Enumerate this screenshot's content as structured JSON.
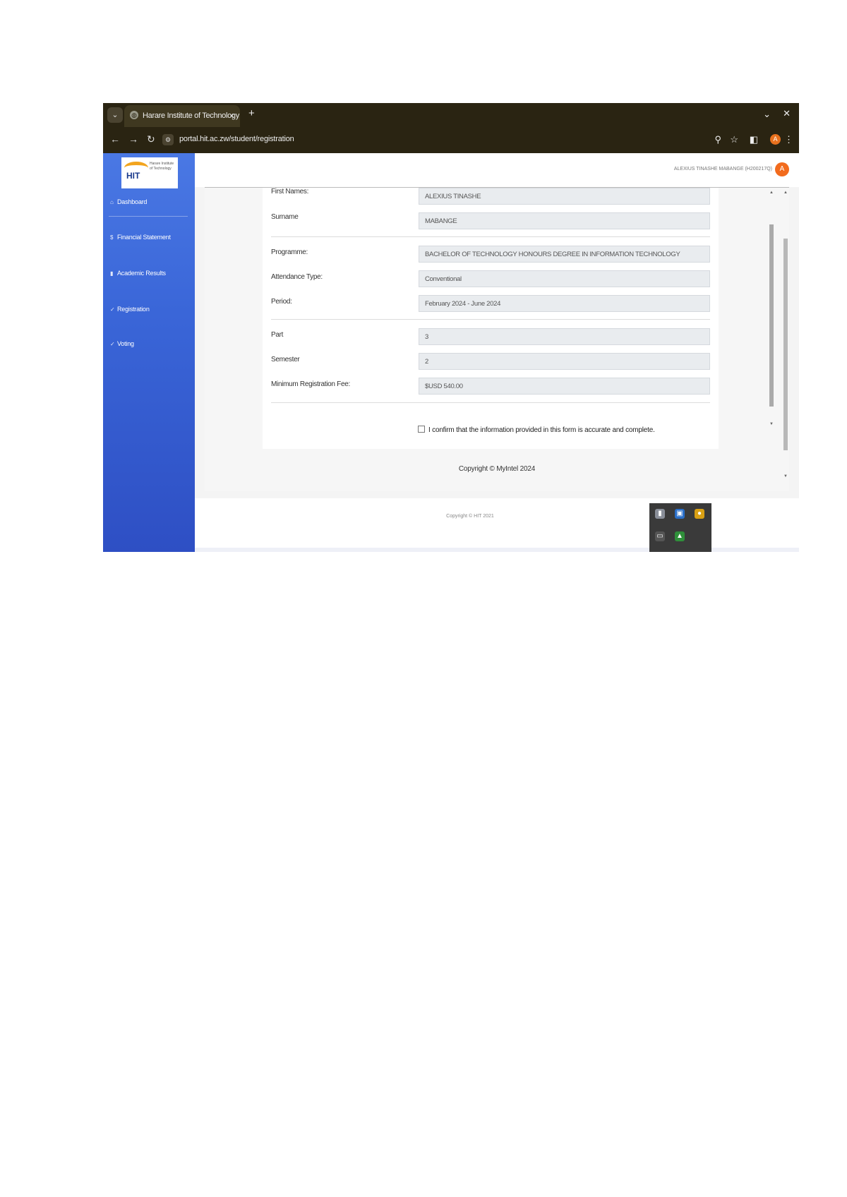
{
  "browser": {
    "tab_title": "Harare Institute of Technology",
    "tab_close": "×",
    "new_tab": "+",
    "url": "portal.hit.ac.zw/student/registration",
    "profile_initial": "A",
    "window_minimize": "⌄",
    "window_close": "✕"
  },
  "sidebar": {
    "logo_text": "HIT",
    "logo_subtext": "Harare Institute of Technology",
    "items": [
      {
        "label": "Dashboard",
        "icon": "home-icon"
      },
      {
        "label": "Financial Statement",
        "icon": "dollar-icon"
      },
      {
        "label": "Academic Results",
        "icon": "document-icon"
      },
      {
        "label": "Registration",
        "icon": "check-icon"
      },
      {
        "label": "Voting",
        "icon": "check-icon"
      }
    ]
  },
  "header": {
    "user_name": "ALEXIUS TINASHE MABANGE (H200217Q)",
    "avatar_initial": "A"
  },
  "form": {
    "fields": [
      {
        "label": "First Names:",
        "value": "ALEXIUS TINASHE"
      },
      {
        "label": "Surname",
        "value": "MABANGE"
      },
      {
        "label": "Programme:",
        "value": "BACHELOR OF TECHNOLOGY HONOURS DEGREE IN INFORMATION TECHNOLOGY"
      },
      {
        "label": "Attendance Type:",
        "value": "Conventional"
      },
      {
        "label": "Period:",
        "value": "February 2024 - June 2024"
      },
      {
        "label": "Part",
        "value": "3"
      },
      {
        "label": "Semester",
        "value": "2"
      },
      {
        "label": "Minimum Registration Fee:",
        "value": "$USD 540.00"
      }
    ],
    "confirm_text": "I confirm that the information provided in this form is accurate and complete."
  },
  "inner_copyright": "Copyright © MyIntel 2024",
  "footer": {
    "text": "Copyright © HIT 2021"
  },
  "colors": {
    "sidebar": "#3a66d8",
    "browser_chrome": "#2a2412",
    "accent": "#f26b1d"
  }
}
